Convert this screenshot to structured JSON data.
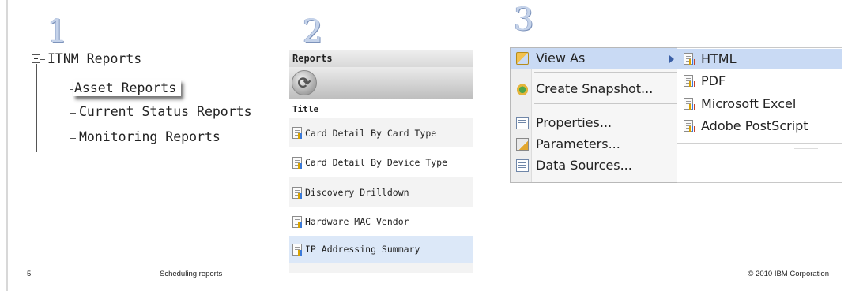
{
  "steps": [
    "1",
    "2",
    "3"
  ],
  "tree": {
    "root_label": "ITNM Reports",
    "children": [
      "Asset Reports",
      "Current Status Reports",
      "Monitoring Reports"
    ],
    "selected": "Asset Reports"
  },
  "reports_panel": {
    "header": "Reports",
    "column_title": "Title",
    "rows": [
      "Card Detail By Card Type",
      "Card Detail By Device Type",
      "Discovery Drilldown",
      "Hardware MAC Vendor",
      "IP Addressing Summary"
    ],
    "highlighted_row": "IP Addressing Summary"
  },
  "context_menu": {
    "items": [
      {
        "label": "View As",
        "icon": "view-as-icon",
        "has_submenu": true
      },
      {
        "label": "Create Snapshot...",
        "icon": "snapshot-icon"
      },
      {
        "label": "Properties...",
        "icon": "properties-icon"
      },
      {
        "label": "Parameters...",
        "icon": "parameters-icon"
      },
      {
        "label": "Data Sources...",
        "icon": "data-sources-icon"
      }
    ],
    "submenu": [
      "HTML",
      "PDF",
      "Microsoft Excel",
      "Adobe PostScript"
    ],
    "submenu_highlighted": "HTML"
  },
  "footer": {
    "page_number": "5",
    "title": "Scheduling reports",
    "copyright": "© 2010 IBM Corporation"
  },
  "colors": {
    "step_number": "#c5d3ea",
    "highlight": "#c9daf4",
    "row_highlight": "#dce8f8"
  }
}
